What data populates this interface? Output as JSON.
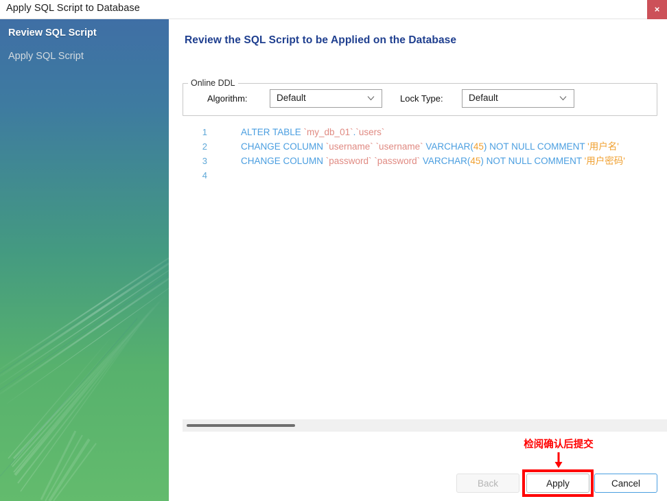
{
  "window": {
    "title": "Apply SQL Script to Database",
    "close_icon": "close-icon",
    "close_glyph": "×",
    "close_color": "#cc5159"
  },
  "sidebar": {
    "gradient_top": "#3f6fa5",
    "gradient_bottom": "#63bb6d",
    "items": [
      {
        "label": "Review SQL Script",
        "state": "active"
      },
      {
        "label": "Apply SQL Script",
        "state": "inactive"
      }
    ]
  },
  "main": {
    "heading": "Review the SQL Script to be Applied on the Database",
    "heading_color": "#1f3f8f",
    "ddl": {
      "legend": "Online DDL",
      "algorithm": {
        "label": "Algorithm:",
        "value": "Default",
        "chevron_icon": "chevron-down-icon"
      },
      "lock_type": {
        "label": "Lock Type:",
        "value": "Default",
        "chevron_icon": "chevron-down-icon"
      }
    },
    "editor": {
      "lines": [
        {
          "number": "1",
          "tokens": [
            {
              "t": "ALTER TABLE ",
              "c": "kw"
            },
            {
              "t": "`my_db_01`",
              "c": "id"
            },
            {
              "t": ".",
              "c": "pn"
            },
            {
              "t": "`users`",
              "c": "id"
            }
          ]
        },
        {
          "number": "2",
          "tokens": [
            {
              "t": "CHANGE COLUMN ",
              "c": "kw"
            },
            {
              "t": "`username`",
              "c": "id"
            },
            {
              "t": " ",
              "c": "pn"
            },
            {
              "t": "`username`",
              "c": "id"
            },
            {
              "t": " VARCHAR",
              "c": "kw"
            },
            {
              "t": "(",
              "c": "pn"
            },
            {
              "t": "45",
              "c": "num"
            },
            {
              "t": ")",
              "c": "pn"
            },
            {
              "t": " NOT NULL COMMENT ",
              "c": "kw"
            },
            {
              "t": "'用户名'",
              "c": "str"
            }
          ]
        },
        {
          "number": "3",
          "tokens": [
            {
              "t": "CHANGE COLUMN ",
              "c": "kw"
            },
            {
              "t": "`password`",
              "c": "id"
            },
            {
              "t": " ",
              "c": "pn"
            },
            {
              "t": "`password`",
              "c": "id"
            },
            {
              "t": " VARCHAR",
              "c": "kw"
            },
            {
              "t": "(",
              "c": "pn"
            },
            {
              "t": "45",
              "c": "num"
            },
            {
              "t": ")",
              "c": "pn"
            },
            {
              "t": " NOT NULL COMMENT ",
              "c": "kw"
            },
            {
              "t": "'用户密码'",
              "c": "str"
            }
          ]
        },
        {
          "number": "4",
          "tokens": []
        }
      ],
      "colors": {
        "keyword": "#4a9ee0",
        "identifier": "#e08a82",
        "number": "#f0a030",
        "string": "#f0a030",
        "line_number": "#5fa8d8"
      }
    }
  },
  "footer": {
    "back_label": "Back",
    "apply_label": "Apply",
    "cancel_label": "Cancel"
  },
  "annotation": {
    "text": "检阅确认后提交",
    "color": "#ff0000",
    "arrow_icon": "arrow-down-icon",
    "target": "Apply"
  }
}
